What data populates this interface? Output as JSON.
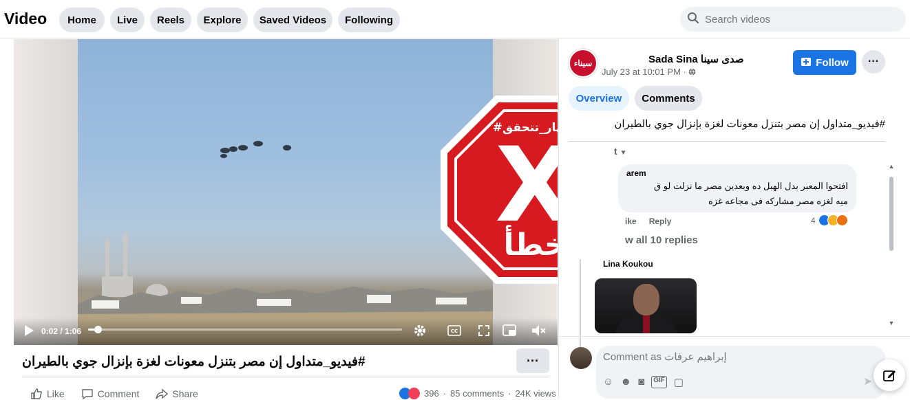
{
  "header": {
    "title": "Video",
    "nav": [
      "Home",
      "Live",
      "Reels",
      "Explore",
      "Saved Videos",
      "Following"
    ],
    "search_placeholder": "Search videos"
  },
  "video": {
    "time": "0:02 / 1:06",
    "progress": 0.03,
    "overlay": {
      "brand": "#النهار_تتحقق",
      "mark": "X",
      "verdict": "خطأ",
      "color": "#d71920"
    },
    "icons": [
      "play-icon",
      "settings-icon",
      "captions-icon",
      "fullscreen-icon",
      "miniplayer-icon",
      "mute-icon"
    ]
  },
  "post": {
    "title": "#فيديو_متداول إن مصر بتنزل معونات لغزة بإنزال جوي بالطيران",
    "more": "···",
    "actions": {
      "like": "Like",
      "comment": "Comment",
      "share": "Share"
    },
    "reactions_count": "396",
    "comments_count": "85 comments",
    "views": "24K views"
  },
  "panel": {
    "page_name": "Sada Sina صدى سينا",
    "avatar_text": "سيناء",
    "post_time": "July 23 at 10:01 PM ·",
    "follow": "Follow",
    "more": "···",
    "tabs": {
      "overview": "Overview",
      "comments": "Comments"
    },
    "caption": "#فيديو_متداول إن مصر بتنزل معونات لغزة بإنزال جوي بالطيران",
    "sort_label": "t",
    "comment": {
      "author": "arem",
      "line1": "افتحوا المعبر بدل الهبل ده وبعدين مصر ما نزلت لو ق",
      "line2": "ميه لغزه مصر مشاركه فى مجاعه غزه",
      "like": "ike",
      "reply": "Reply",
      "reaction_count": "4"
    },
    "view_replies": "w all 10 replies",
    "reply_author": "Lina Koukou",
    "composer_placeholder": "Comment as إبراهيم عرفات"
  },
  "colors": {
    "accent": "#1b74e4",
    "warning_red": "#d71920"
  }
}
